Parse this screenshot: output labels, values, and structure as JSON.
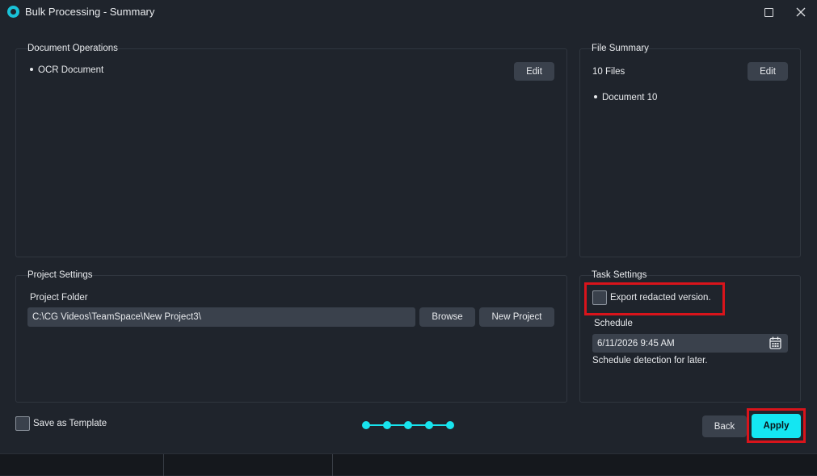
{
  "window": {
    "title": "Bulk Processing - Summary"
  },
  "document_operations": {
    "label": "Document Operations",
    "items": [
      "OCR Document"
    ],
    "edit_label": "Edit"
  },
  "file_summary": {
    "label": "File Summary",
    "count_text": "10 Files",
    "edit_label": "Edit",
    "items": [
      "Document 10"
    ]
  },
  "project_settings": {
    "label": "Project Settings",
    "folder_label": "Project Folder",
    "folder_value": "C:\\CG Videos\\TeamSpace\\New Project3\\",
    "browse_label": "Browse",
    "new_project_label": "New Project"
  },
  "task_settings": {
    "label": "Task Settings",
    "export_redacted_label": "Export redacted version.",
    "export_redacted_checked": false,
    "schedule_label": "Schedule",
    "schedule_value": "6/11/2026 9:45 AM",
    "schedule_hint": "Schedule detection for later."
  },
  "footer": {
    "save_template_label": "Save as Template",
    "save_template_checked": false,
    "steps_total": 5,
    "back_label": "Back",
    "apply_label": "Apply"
  },
  "colors": {
    "accent": "#14e6f2",
    "highlight": "#d9141b",
    "background": "#1f242c",
    "button": "#3a414c"
  },
  "icons": {
    "app": "app-logo-icon",
    "maximize": "maximize-icon",
    "close": "close-icon",
    "calendar": "calendar-icon"
  }
}
